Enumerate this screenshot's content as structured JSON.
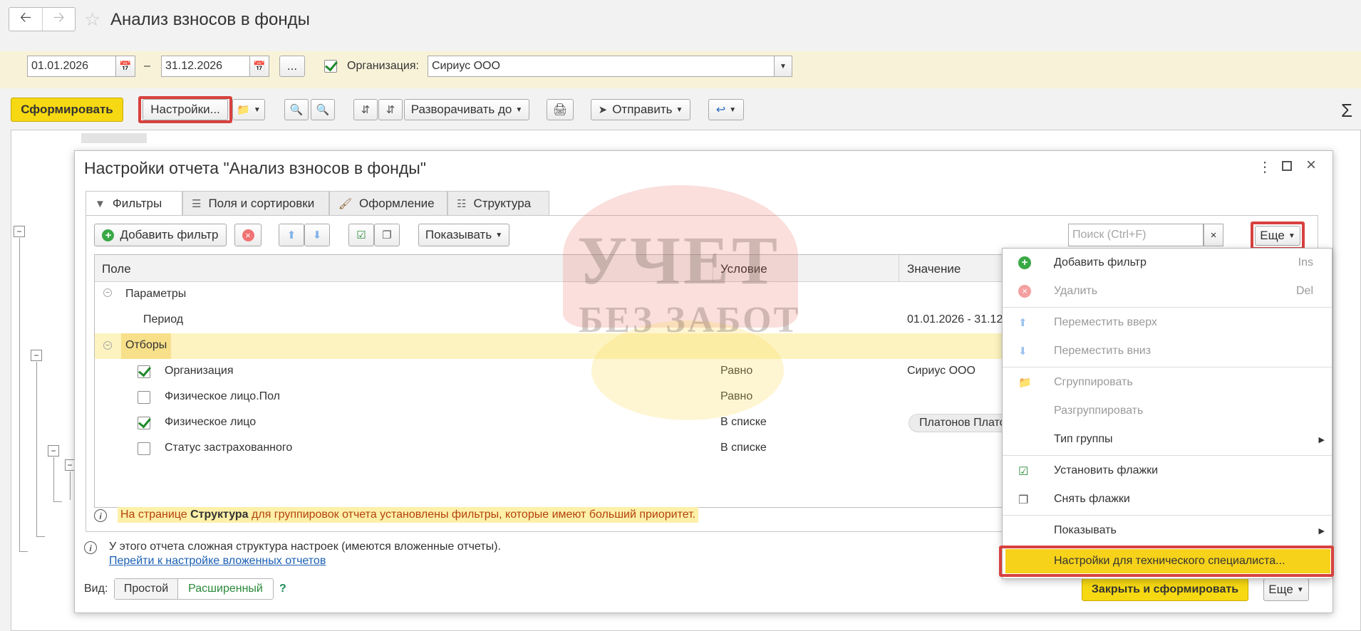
{
  "window": {
    "title": "Анализ взносов в фонды"
  },
  "filters": {
    "date_from": "01.01.2026",
    "date_to": "31.12.2026",
    "date_separator": "–",
    "more_dots": "...",
    "org_label": "Организация:",
    "org_value": "Сириус ООО"
  },
  "toolbar": {
    "generate": "Сформировать",
    "settings": "Настройки...",
    "expand_to": "Разворачивать до",
    "send": "Отправить",
    "sum_symbol": "Σ"
  },
  "dialog": {
    "title": "Настройки отчета \"Анализ взносов в фонды\"",
    "tabs": [
      "Фильтры",
      "Поля и сортировки",
      "Оформление",
      "Структура"
    ],
    "add_filter": "Добавить фильтр",
    "show": "Показывать",
    "search_placeholder": "Поиск (Ctrl+F)",
    "search_clear": "×",
    "more": "Еще",
    "columns": {
      "field": "Поле",
      "condition": "Условие",
      "value": "Значение"
    },
    "rows": [
      {
        "field": "Параметры",
        "condition": "",
        "value": ""
      },
      {
        "field": "Период",
        "condition": "",
        "value": "01.01.2026 - 31.12.2026"
      },
      {
        "field": "Отборы",
        "condition": "",
        "value": ""
      },
      {
        "field": "Организация",
        "condition": "Равно",
        "value": "Сириус ООО",
        "checked": true
      },
      {
        "field": "Физическое лицо.Пол",
        "condition": "Равно",
        "value": "",
        "checked": false
      },
      {
        "field": "Физическое лицо",
        "condition": "В списке",
        "value": "Платонов Платон",
        "checked": true
      },
      {
        "field": "Статус застрахованного",
        "condition": "В списке",
        "value": "",
        "checked": false
      }
    ],
    "info_prefix": "На странице ",
    "info_bold": "Структура",
    "info_suffix": " для группировок отчета установлены фильтры, которые имеют больший приоритет.",
    "structure_note": "У этого отчета сложная структура настроек (имеются вложенные отчеты).",
    "structure_link": "Перейти к настройке вложенных отчетов",
    "view_label": "Вид:",
    "view_simple": "Простой",
    "view_extended": "Расширенный",
    "help": "?",
    "close_and_generate": "Закрыть и сформировать",
    "more_bottom": "Еще"
  },
  "menu": {
    "add_filter": "Добавить фильтр",
    "add_filter_key": "Ins",
    "delete": "Удалить",
    "delete_key": "Del",
    "move_up": "Переместить вверх",
    "move_down": "Переместить вниз",
    "group": "Сгруппировать",
    "ungroup": "Разгруппировать",
    "group_type": "Тип группы",
    "set_flags": "Установить флажки",
    "clear_flags": "Снять флажки",
    "show": "Показывать",
    "tech_settings": "Настройки для технического специалиста..."
  },
  "watermark": {
    "line1": "УЧЕТ",
    "line2": "БЕЗ ЗАБОТ"
  },
  "colors": {
    "accent_yellow": "#f6d912",
    "highlight_row": "#fdf3c0",
    "red_frame": "#d7413e",
    "link": "#1a5fb4",
    "green_check": "#1f8a2b"
  }
}
